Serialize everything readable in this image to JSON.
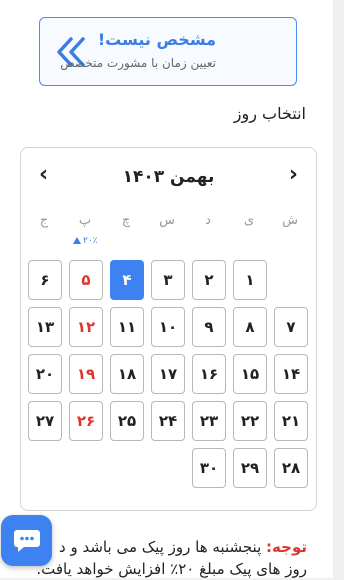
{
  "banner": {
    "title": "مشخص نیست!",
    "subtitle": "تعیین زمان با مشورت متخصص",
    "icon": "double-chevron-left-icon"
  },
  "section_label": "انتخاب روز",
  "calendar": {
    "month_title": "بهمن ۱۴۰۳",
    "prev_symbol": "‹",
    "next_symbol": "›",
    "weekdays": [
      "ش",
      "ی",
      "د",
      "س",
      "چ",
      "پ",
      "ج"
    ],
    "peak_note": "۲۰٪",
    "days": [
      {
        "label": "۱",
        "holiday": false,
        "selected": false
      },
      {
        "label": "۲",
        "holiday": false,
        "selected": false
      },
      {
        "label": "۳",
        "holiday": false,
        "selected": false
      },
      {
        "label": "۴",
        "holiday": false,
        "selected": true
      },
      {
        "label": "۵",
        "holiday": true,
        "selected": false
      },
      {
        "label": "۶",
        "holiday": false,
        "selected": false
      },
      {
        "label": "۷",
        "holiday": false,
        "selected": false
      },
      {
        "label": "۸",
        "holiday": false,
        "selected": false
      },
      {
        "label": "۹",
        "holiday": false,
        "selected": false
      },
      {
        "label": "۱۰",
        "holiday": false,
        "selected": false
      },
      {
        "label": "۱۱",
        "holiday": false,
        "selected": false
      },
      {
        "label": "۱۲",
        "holiday": true,
        "selected": false
      },
      {
        "label": "۱۳",
        "holiday": false,
        "selected": false
      },
      {
        "label": "۱۴",
        "holiday": false,
        "selected": false
      },
      {
        "label": "۱۵",
        "holiday": false,
        "selected": false
      },
      {
        "label": "۱۶",
        "holiday": false,
        "selected": false
      },
      {
        "label": "۱۷",
        "holiday": false,
        "selected": false
      },
      {
        "label": "۱۸",
        "holiday": false,
        "selected": false
      },
      {
        "label": "۱۹",
        "holiday": true,
        "selected": false
      },
      {
        "label": "۲۰",
        "holiday": false,
        "selected": false
      },
      {
        "label": "۲۱",
        "holiday": false,
        "selected": false
      },
      {
        "label": "۲۲",
        "holiday": false,
        "selected": false
      },
      {
        "label": "۲۳",
        "holiday": false,
        "selected": false
      },
      {
        "label": "۲۴",
        "holiday": false,
        "selected": false
      },
      {
        "label": "۲۵",
        "holiday": false,
        "selected": false
      },
      {
        "label": "۲۶",
        "holiday": true,
        "selected": false
      },
      {
        "label": "۲۷",
        "holiday": false,
        "selected": false
      },
      {
        "label": "۲۸",
        "holiday": false,
        "selected": false
      },
      {
        "label": "۲۹",
        "holiday": false,
        "selected": false
      },
      {
        "label": "۳۰",
        "holiday": false,
        "selected": false
      }
    ]
  },
  "note": {
    "label": "توجه:",
    "line1": "پنجشنبه ها روز پیک می باشد و د",
    "line2": "روز های پیک مبلغ ۲۰٪ افزایش خواهد یافت."
  },
  "colors": {
    "accent": "#3d82f0",
    "holiday": "#e0342e"
  },
  "chat_widget": {
    "icon": "chat-bubble-icon"
  }
}
